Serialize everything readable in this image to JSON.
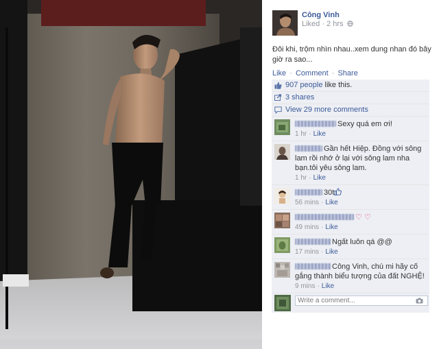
{
  "post": {
    "author": "Công Vinh",
    "meta": "Liked · 2 hrs",
    "caption": "Đôi khi, trộm nhìn nhau..xem dung nhan đó bây giờ ra sao...",
    "actions": {
      "like": "Like",
      "comment": "Comment",
      "share": "Share",
      "separator": "·"
    }
  },
  "ufi": {
    "likes_count": "907 people",
    "likes_suffix": "like this.",
    "shares": "3 shares",
    "view_more": "View 29 more comments",
    "like_label": "Like",
    "comments": [
      {
        "text": "Sexy quá em ơi!",
        "time": "1 hr"
      },
      {
        "text": "Gần hết Hiệp. Đồng với sông lam rồi nhớ ở lại với sông lam nha bạn.tôi yêu sông lam.",
        "time": "1 hr"
      },
      {
        "text": "30t",
        "time": "56 mins"
      },
      {
        "text": "",
        "time": "49 mins"
      },
      {
        "text": "Ngất luôn qá @@",
        "time": "17 mins"
      },
      {
        "text": "Công Vinh, chú mi hãy cố gắng thành biểu tượng của đất NGHỆ!",
        "time": "9 mins"
      }
    ],
    "compose_placeholder": "Write a comment..."
  },
  "icons": {
    "globe": "globe-icon",
    "thumbs_up": "thumbs-up-icon",
    "share": "share-icon",
    "comments": "comments-icon",
    "heart": "heart-icon",
    "camera": "camera-icon"
  },
  "colors": {
    "link": "#3b5998",
    "ufi_bg": "#edeff4",
    "muted": "#90949c",
    "heart": "#e0245e"
  }
}
